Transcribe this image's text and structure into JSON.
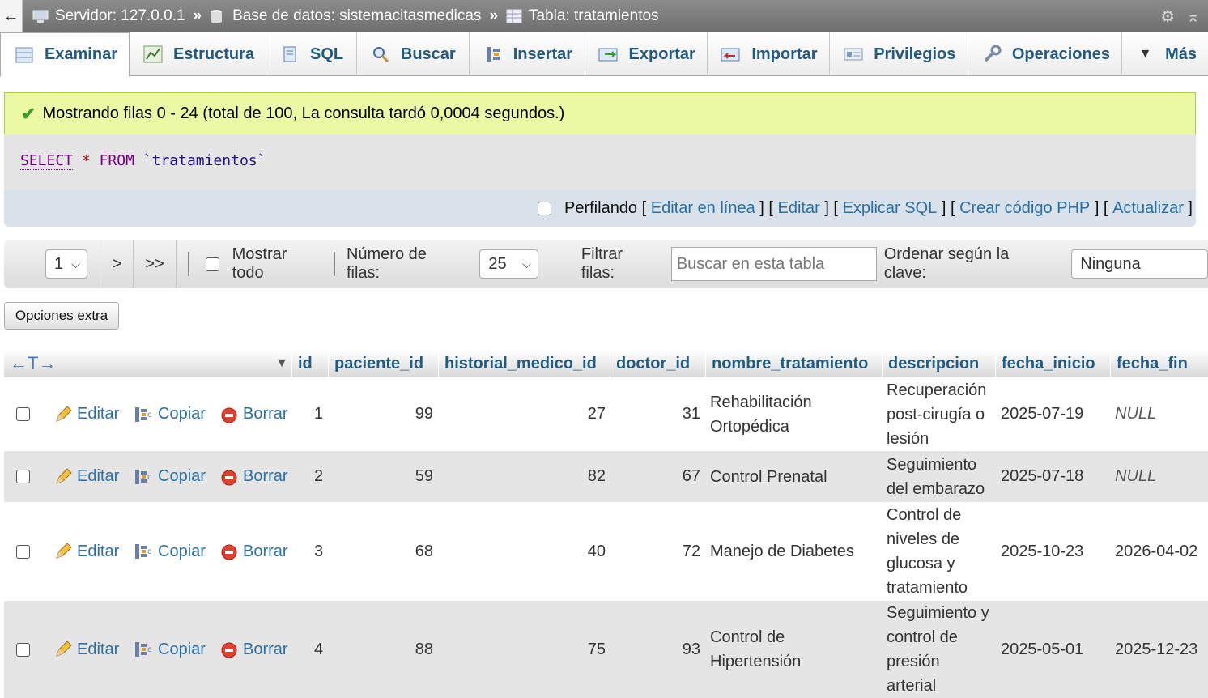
{
  "breadcrumb": {
    "server": "Servidor: 127.0.0.1",
    "database": "Base de datos: sistemacitasmedicas",
    "table": "Tabla: tratamientos",
    "separator": "»"
  },
  "tabs": [
    {
      "label": "Examinar",
      "icon": "browse-icon"
    },
    {
      "label": "Estructura",
      "icon": "structure-icon"
    },
    {
      "label": "SQL",
      "icon": "sql-icon"
    },
    {
      "label": "Buscar",
      "icon": "search-icon"
    },
    {
      "label": "Insertar",
      "icon": "insert-icon"
    },
    {
      "label": "Exportar",
      "icon": "export-icon"
    },
    {
      "label": "Importar",
      "icon": "import-icon"
    },
    {
      "label": "Privilegios",
      "icon": "privileges-icon"
    },
    {
      "label": "Operaciones",
      "icon": "wrench-icon"
    },
    {
      "label": "Más",
      "icon": "dropdown-icon"
    }
  ],
  "message": "Mostrando filas 0 - 24 (total de 100, La consulta tardó 0,0004 segundos.)",
  "sql": {
    "select": "SELECT",
    "star": "*",
    "from": "FROM",
    "table": "`tratamientos`"
  },
  "sql_links": {
    "profiling": "Perfilando",
    "inline_edit": "Editar en línea",
    "edit": "Editar",
    "explain": "Explicar SQL",
    "php": "Crear código PHP",
    "refresh": "Actualizar"
  },
  "nav": {
    "page": "1",
    "next": ">",
    "last": ">>",
    "show_all": "Mostrar todo",
    "rows_label": "Número de filas:",
    "rows_value": "25",
    "filter_label": "Filtrar filas:",
    "filter_placeholder": "Buscar en esta tabla",
    "order_label": "Ordenar según la clave:",
    "order_value": "Ninguna"
  },
  "extra_options": "Opciones extra",
  "columns": [
    "id",
    "paciente_id",
    "historial_medico_id",
    "doctor_id",
    "nombre_tratamiento",
    "descripcion",
    "fecha_inicio",
    "fecha_fin"
  ],
  "actions": {
    "edit": "Editar",
    "copy": "Copiar",
    "delete": "Borrar"
  },
  "rows": [
    {
      "id": "1",
      "paciente_id": "99",
      "historial_medico_id": "27",
      "doctor_id": "31",
      "nombre": [
        "Rehabilitación",
        "Ortopédica"
      ],
      "descripcion": [
        "Recuperación",
        "post-cirugía o",
        "lesión"
      ],
      "fecha_inicio": "2025-07-19",
      "fecha_fin": "NULL"
    },
    {
      "id": "2",
      "paciente_id": "59",
      "historial_medico_id": "82",
      "doctor_id": "67",
      "nombre": [
        "Control Prenatal"
      ],
      "descripcion": [
        "Seguimiento",
        "del embarazo"
      ],
      "fecha_inicio": "2025-07-18",
      "fecha_fin": "NULL"
    },
    {
      "id": "3",
      "paciente_id": "68",
      "historial_medico_id": "40",
      "doctor_id": "72",
      "nombre": [
        "Manejo de Diabetes"
      ],
      "descripcion": [
        "Control de",
        "niveles de",
        "glucosa y",
        "tratamiento"
      ],
      "fecha_inicio": "2025-10-23",
      "fecha_fin": "2026-04-02"
    },
    {
      "id": "4",
      "paciente_id": "88",
      "historial_medico_id": "75",
      "doctor_id": "93",
      "nombre": [
        "Control de",
        "Hipertensión"
      ],
      "descripcion": [
        "Seguimiento y",
        "control de",
        "presión",
        "arterial"
      ],
      "fecha_inicio": "2025-05-01",
      "fecha_fin": "2025-12-23"
    }
  ],
  "colors": {
    "link": "#2b6fa6",
    "header": "#235a81",
    "success_bg": "#ebf8a4"
  }
}
